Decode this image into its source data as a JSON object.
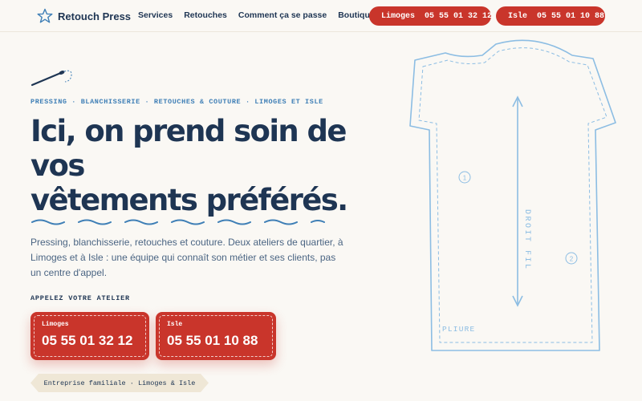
{
  "brand": {
    "name": "Retouch Press",
    "icon": "star-icon"
  },
  "nav": [
    "Services",
    "Retouches",
    "Comment ça se passe",
    "Boutiques"
  ],
  "header_phones": [
    {
      "city": "Limoges",
      "number": "05 55 01 32 12",
      "icon": "phone-icon"
    },
    {
      "city": "Isle",
      "number": "05 55 01 10 88",
      "icon": "phone-icon"
    }
  ],
  "hero": {
    "eyebrow": "PRESSING · BLANCHISSERIE · RETOUCHES & COUTURE · LIMOGES ET ISLE",
    "headline_line1": "Ici, on prend soin de",
    "headline_line2": "vos",
    "headline_line3": "vêtements préférés.",
    "lead": "Pressing, blanchisserie, retouches et couture. Deux ateliers de quartier, à Limoges et à Isle : une équipe qui connaît son métier et ses clients, pas un centre d'appel.",
    "call_label": "APPELEZ VOTRE ATELIER",
    "phones": [
      {
        "city": "Limoges",
        "number": "05 55 01 32 12"
      },
      {
        "city": "Isle",
        "number": "05 55 01 10 88"
      }
    ],
    "tag": "Entreprise familiale · Limoges & Isle"
  },
  "pattern": {
    "grain_label": "DROIT FIL",
    "fold_label": "PLIURE",
    "markers": [
      "1",
      "2"
    ]
  },
  "colors": {
    "navy": "#1e3553",
    "red": "#c9352b",
    "blue": "#3f7fb6",
    "line": "#8cbde3",
    "background": "#faf8f4"
  }
}
